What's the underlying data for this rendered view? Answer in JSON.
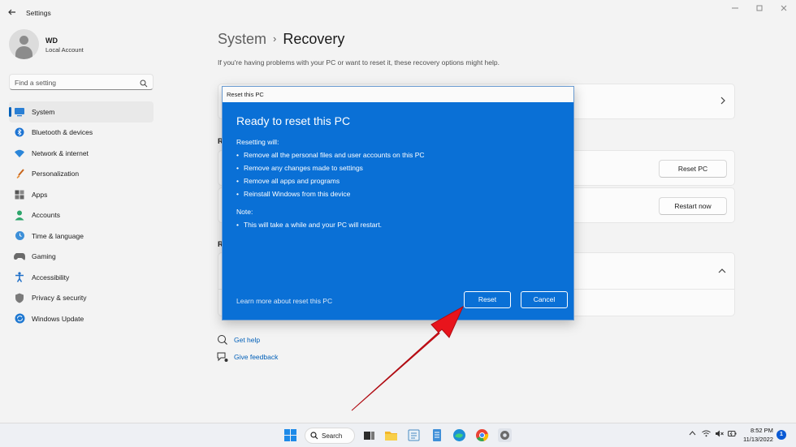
{
  "window": {
    "title": "Settings",
    "back_icon": "back-arrow-icon"
  },
  "profile": {
    "name": "WD",
    "account_type": "Local Account"
  },
  "search": {
    "placeholder": "Find a setting",
    "icon": "search-icon"
  },
  "sidebar": {
    "items": [
      {
        "label": "System",
        "icon": "system-monitor-icon",
        "active": true
      },
      {
        "label": "Bluetooth & devices",
        "icon": "bluetooth-icon",
        "active": false
      },
      {
        "label": "Network & internet",
        "icon": "wifi-icon",
        "active": false
      },
      {
        "label": "Personalization",
        "icon": "brush-icon",
        "active": false
      },
      {
        "label": "Apps",
        "icon": "apps-grid-icon",
        "active": false
      },
      {
        "label": "Accounts",
        "icon": "person-icon",
        "active": false
      },
      {
        "label": "Time & language",
        "icon": "globe-clock-icon",
        "active": false
      },
      {
        "label": "Gaming",
        "icon": "gamepad-icon",
        "active": false
      },
      {
        "label": "Accessibility",
        "icon": "accessibility-icon",
        "active": false
      },
      {
        "label": "Privacy & security",
        "icon": "shield-icon",
        "active": false
      },
      {
        "label": "Windows Update",
        "icon": "update-icon",
        "active": false
      }
    ]
  },
  "main": {
    "breadcrumb_parent": "System",
    "breadcrumb_separator": "›",
    "breadcrumb_current": "Recovery",
    "intro": "If you're having problems with your PC or want to reset it, these recovery options might help.",
    "section_letter_1": "R",
    "section_letter_2": "R",
    "reset_pc_button": "Reset PC",
    "restart_now_button": "Restart now",
    "links": [
      {
        "label": "Get help",
        "icon": "help-chat-icon"
      },
      {
        "label": "Give feedback",
        "icon": "feedback-icon"
      }
    ]
  },
  "dialog": {
    "window_title": "Reset this PC",
    "heading": "Ready to reset this PC",
    "resetting_label": "Resetting will:",
    "bullets": [
      "Remove all the personal files and user accounts on this PC",
      "Remove any changes made to settings",
      "Remove all apps and programs",
      "Reinstall Windows from this device"
    ],
    "note_label": "Note:",
    "note_bullets": [
      "This will take a while and your PC will restart."
    ],
    "learn_more": "Learn more about reset this PC",
    "reset_button": "Reset",
    "cancel_button": "Cancel"
  },
  "taskbar": {
    "search_label": "Search",
    "time": "8:52 PM",
    "date": "11/13/2022",
    "notification_count": "1"
  },
  "colors": {
    "accent": "#005fb8",
    "dialog_bg": "#0a70d6",
    "annotation_arrow": "#e8141c"
  }
}
